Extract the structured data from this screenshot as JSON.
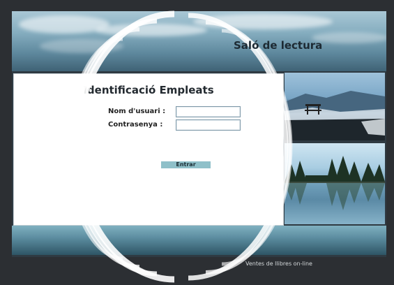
{
  "header": {
    "title": "Saló de lectura"
  },
  "login": {
    "title": "Identificació Empleats",
    "username_label": "Nom d'usuari :",
    "username_value": "",
    "password_label": "Contrasenya :",
    "password_value": "",
    "submit_label": "Entrar"
  },
  "footer": {
    "text": "Ventes de llibres on-line"
  },
  "colors": {
    "button": "#8fc0c9",
    "panel": "#ffffff",
    "background": "#2c2f33"
  }
}
